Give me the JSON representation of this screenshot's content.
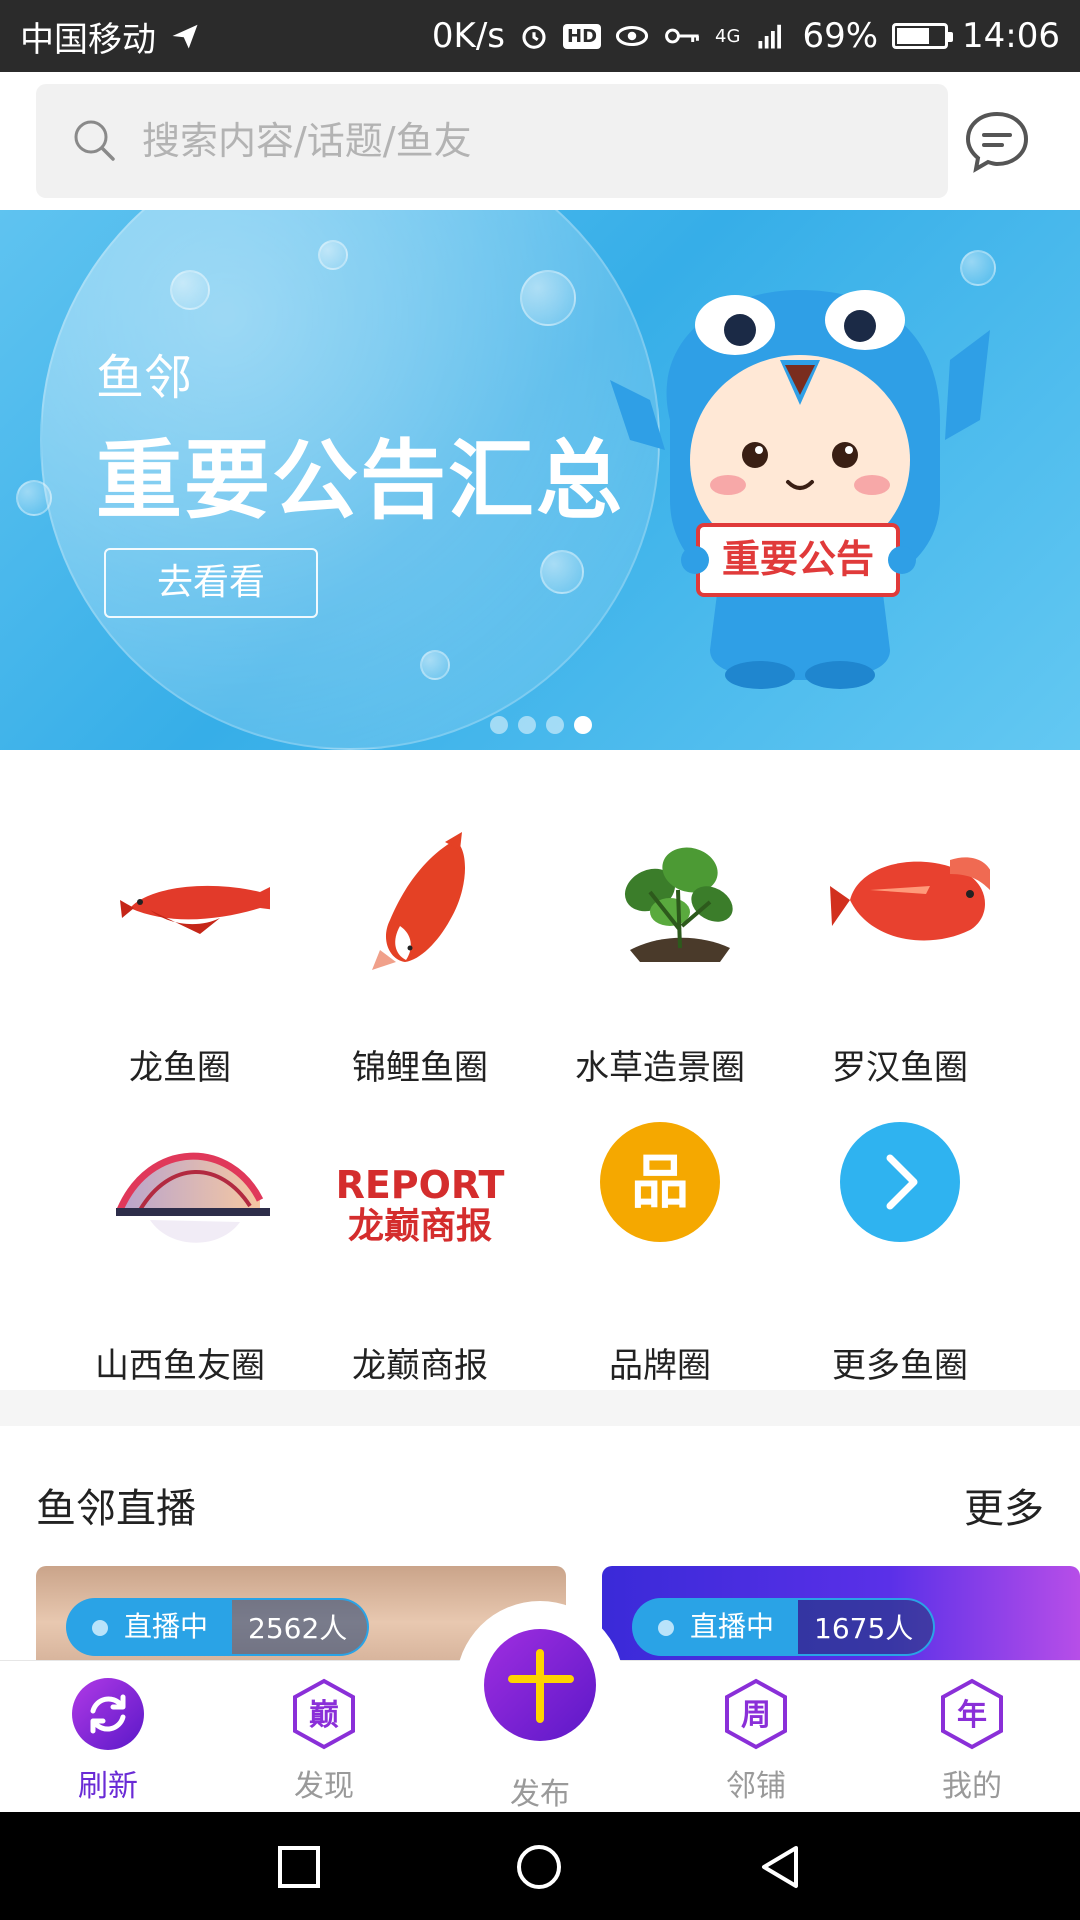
{
  "status_bar": {
    "carrier": "中国移动",
    "net_speed": "0K/s",
    "hd": "HD",
    "network_type": "4G",
    "battery_percent": "69%",
    "battery_level": 0.69,
    "time": "14:06"
  },
  "search": {
    "placeholder": "搜索内容/话题/鱼友"
  },
  "banner": {
    "small_title": "鱼邻",
    "title": "重要公告汇总",
    "button": "去看看",
    "sign_text": "重要公告",
    "page_count": 4,
    "active_index": 3
  },
  "categories": [
    {
      "label": "龙鱼圈",
      "icon": "arowana-fish-image"
    },
    {
      "label": "锦鲤鱼圈",
      "icon": "koi-fish-image"
    },
    {
      "label": "水草造景圈",
      "icon": "aquatic-plant-image"
    },
    {
      "label": "罗汉鱼圈",
      "icon": "flowerhorn-fish-image"
    },
    {
      "label": "山西鱼友圈",
      "icon": "bridge-image"
    },
    {
      "label": "龙巅商报",
      "icon": "report-logo",
      "logo_line1": "REPORT",
      "logo_line2": "龙巅商报"
    },
    {
      "label": "品牌圈",
      "icon": "brand-icon",
      "glyph": "品"
    },
    {
      "label": "更多鱼圈",
      "icon": "chevron-right-icon"
    }
  ],
  "live": {
    "title": "鱼邻直播",
    "more": "更多",
    "cards": [
      {
        "status": "直播中",
        "viewers": "2562人"
      },
      {
        "status": "直播中",
        "viewers": "1675人"
      }
    ]
  },
  "bottom_nav": {
    "items": [
      {
        "label": "刷新",
        "icon": "refresh-icon",
        "active": true
      },
      {
        "label": "发现",
        "icon": "discover-icon",
        "glyph": "巅"
      },
      {
        "label": "发布",
        "icon": "plus-icon"
      },
      {
        "label": "邻铺",
        "icon": "shop-icon",
        "glyph": "周"
      },
      {
        "label": "我的",
        "icon": "profile-icon",
        "glyph": "年"
      }
    ]
  },
  "colors": {
    "accent_purple": "#6a2bd6",
    "brand_orange": "#f5a800",
    "more_blue": "#2fb3f0",
    "live_blue": "#2aa3e6"
  }
}
